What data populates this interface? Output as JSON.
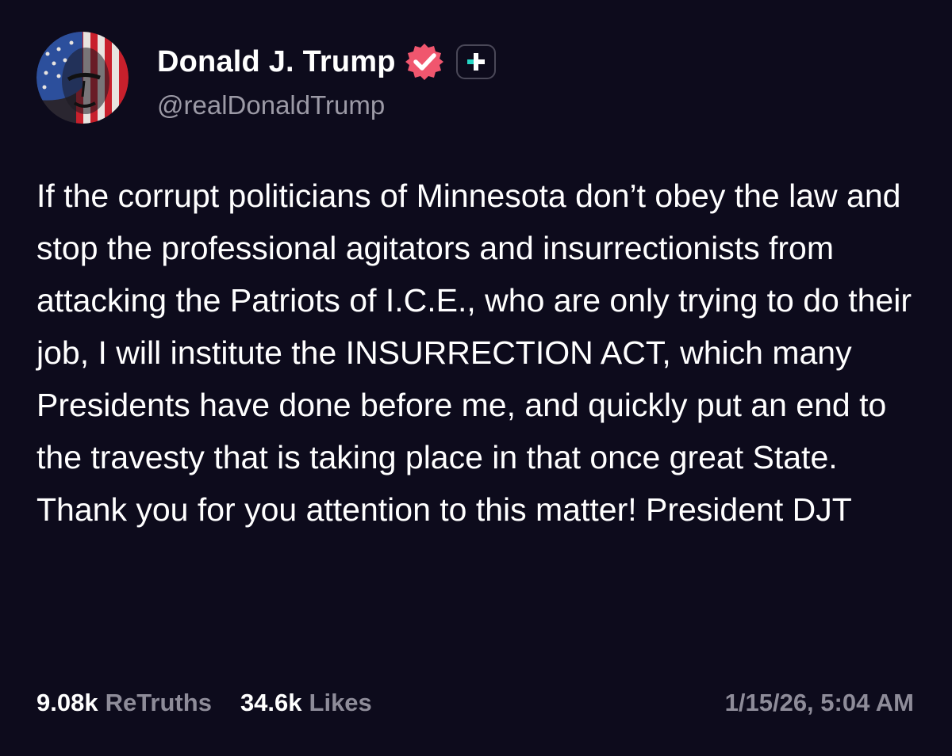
{
  "post": {
    "author": {
      "display_name": "Donald J. Trump",
      "handle": "@realDonaldTrump",
      "verified": true,
      "verified_badge_color": "#f0566e",
      "plus_badge_icon": "plus-icon",
      "plus_badge_accent": "#25d6c4"
    },
    "text": "If the corrupt politicians of Minnesota don’t obey the law and stop the professional agitators and insurrectionists from attacking the Patriots of I.C.E., who are only trying to do their job, I will institute the INSURRECTION ACT, which many Presidents have done before me, and quickly put an end to the travesty that is taking place in that once great State. Thank you for you attention to this matter! President DJT",
    "stats": {
      "retruths_count": "9.08k",
      "retruths_label": "ReTruths",
      "likes_count": "34.6k",
      "likes_label": "Likes"
    },
    "timestamp": "1/15/26, 5:04 AM"
  },
  "theme": {
    "background": "#0d0b1c",
    "text_primary": "#ffffff",
    "text_secondary": "#8e8c99"
  }
}
